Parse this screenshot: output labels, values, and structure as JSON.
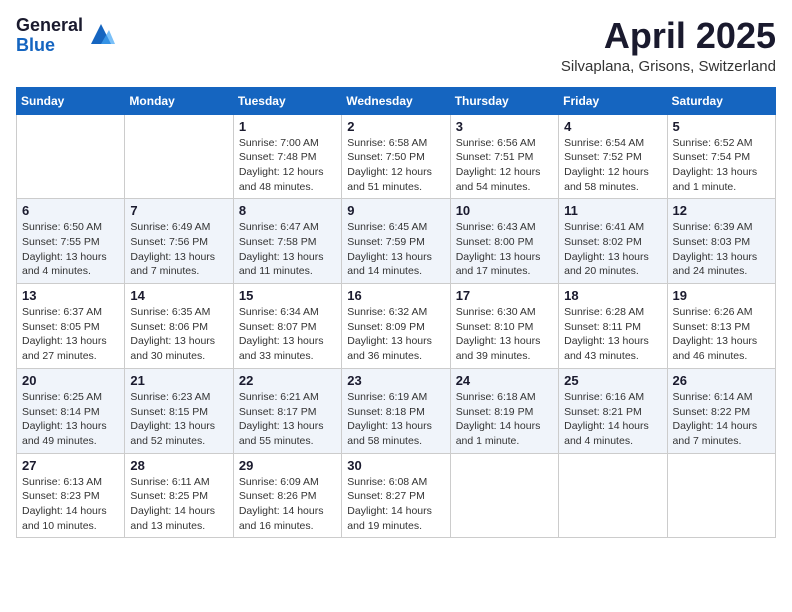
{
  "header": {
    "logo_general": "General",
    "logo_blue": "Blue",
    "month_title": "April 2025",
    "location": "Silvaplana, Grisons, Switzerland"
  },
  "weekdays": [
    "Sunday",
    "Monday",
    "Tuesday",
    "Wednesday",
    "Thursday",
    "Friday",
    "Saturday"
  ],
  "weeks": [
    [
      {
        "day": "",
        "info": ""
      },
      {
        "day": "",
        "info": ""
      },
      {
        "day": "1",
        "info": "Sunrise: 7:00 AM\nSunset: 7:48 PM\nDaylight: 12 hours\nand 48 minutes."
      },
      {
        "day": "2",
        "info": "Sunrise: 6:58 AM\nSunset: 7:50 PM\nDaylight: 12 hours\nand 51 minutes."
      },
      {
        "day": "3",
        "info": "Sunrise: 6:56 AM\nSunset: 7:51 PM\nDaylight: 12 hours\nand 54 minutes."
      },
      {
        "day": "4",
        "info": "Sunrise: 6:54 AM\nSunset: 7:52 PM\nDaylight: 12 hours\nand 58 minutes."
      },
      {
        "day": "5",
        "info": "Sunrise: 6:52 AM\nSunset: 7:54 PM\nDaylight: 13 hours\nand 1 minute."
      }
    ],
    [
      {
        "day": "6",
        "info": "Sunrise: 6:50 AM\nSunset: 7:55 PM\nDaylight: 13 hours\nand 4 minutes."
      },
      {
        "day": "7",
        "info": "Sunrise: 6:49 AM\nSunset: 7:56 PM\nDaylight: 13 hours\nand 7 minutes."
      },
      {
        "day": "8",
        "info": "Sunrise: 6:47 AM\nSunset: 7:58 PM\nDaylight: 13 hours\nand 11 minutes."
      },
      {
        "day": "9",
        "info": "Sunrise: 6:45 AM\nSunset: 7:59 PM\nDaylight: 13 hours\nand 14 minutes."
      },
      {
        "day": "10",
        "info": "Sunrise: 6:43 AM\nSunset: 8:00 PM\nDaylight: 13 hours\nand 17 minutes."
      },
      {
        "day": "11",
        "info": "Sunrise: 6:41 AM\nSunset: 8:02 PM\nDaylight: 13 hours\nand 20 minutes."
      },
      {
        "day": "12",
        "info": "Sunrise: 6:39 AM\nSunset: 8:03 PM\nDaylight: 13 hours\nand 24 minutes."
      }
    ],
    [
      {
        "day": "13",
        "info": "Sunrise: 6:37 AM\nSunset: 8:05 PM\nDaylight: 13 hours\nand 27 minutes."
      },
      {
        "day": "14",
        "info": "Sunrise: 6:35 AM\nSunset: 8:06 PM\nDaylight: 13 hours\nand 30 minutes."
      },
      {
        "day": "15",
        "info": "Sunrise: 6:34 AM\nSunset: 8:07 PM\nDaylight: 13 hours\nand 33 minutes."
      },
      {
        "day": "16",
        "info": "Sunrise: 6:32 AM\nSunset: 8:09 PM\nDaylight: 13 hours\nand 36 minutes."
      },
      {
        "day": "17",
        "info": "Sunrise: 6:30 AM\nSunset: 8:10 PM\nDaylight: 13 hours\nand 39 minutes."
      },
      {
        "day": "18",
        "info": "Sunrise: 6:28 AM\nSunset: 8:11 PM\nDaylight: 13 hours\nand 43 minutes."
      },
      {
        "day": "19",
        "info": "Sunrise: 6:26 AM\nSunset: 8:13 PM\nDaylight: 13 hours\nand 46 minutes."
      }
    ],
    [
      {
        "day": "20",
        "info": "Sunrise: 6:25 AM\nSunset: 8:14 PM\nDaylight: 13 hours\nand 49 minutes."
      },
      {
        "day": "21",
        "info": "Sunrise: 6:23 AM\nSunset: 8:15 PM\nDaylight: 13 hours\nand 52 minutes."
      },
      {
        "day": "22",
        "info": "Sunrise: 6:21 AM\nSunset: 8:17 PM\nDaylight: 13 hours\nand 55 minutes."
      },
      {
        "day": "23",
        "info": "Sunrise: 6:19 AM\nSunset: 8:18 PM\nDaylight: 13 hours\nand 58 minutes."
      },
      {
        "day": "24",
        "info": "Sunrise: 6:18 AM\nSunset: 8:19 PM\nDaylight: 14 hours\nand 1 minute."
      },
      {
        "day": "25",
        "info": "Sunrise: 6:16 AM\nSunset: 8:21 PM\nDaylight: 14 hours\nand 4 minutes."
      },
      {
        "day": "26",
        "info": "Sunrise: 6:14 AM\nSunset: 8:22 PM\nDaylight: 14 hours\nand 7 minutes."
      }
    ],
    [
      {
        "day": "27",
        "info": "Sunrise: 6:13 AM\nSunset: 8:23 PM\nDaylight: 14 hours\nand 10 minutes."
      },
      {
        "day": "28",
        "info": "Sunrise: 6:11 AM\nSunset: 8:25 PM\nDaylight: 14 hours\nand 13 minutes."
      },
      {
        "day": "29",
        "info": "Sunrise: 6:09 AM\nSunset: 8:26 PM\nDaylight: 14 hours\nand 16 minutes."
      },
      {
        "day": "30",
        "info": "Sunrise: 6:08 AM\nSunset: 8:27 PM\nDaylight: 14 hours\nand 19 minutes."
      },
      {
        "day": "",
        "info": ""
      },
      {
        "day": "",
        "info": ""
      },
      {
        "day": "",
        "info": ""
      }
    ]
  ]
}
